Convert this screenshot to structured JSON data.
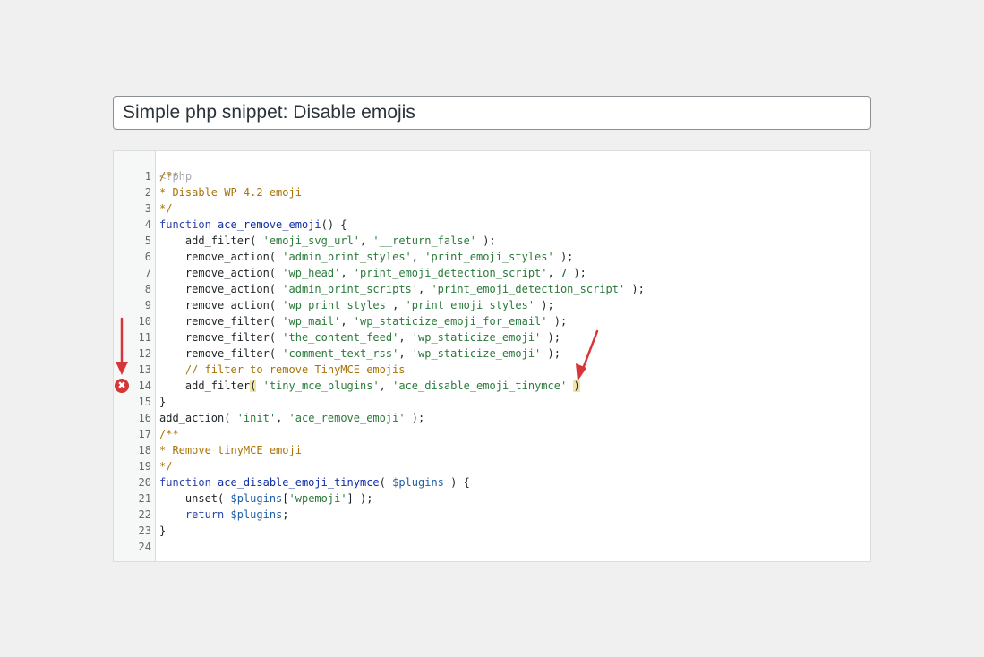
{
  "snippet": {
    "title_value": "Simple php snippet: Disable emojis"
  },
  "editor": {
    "php_open_tag": "<?php",
    "error_line": 14,
    "lines": [
      {
        "n": "1",
        "tokens": [
          [
            "comment",
            "/**"
          ]
        ]
      },
      {
        "n": "2",
        "tokens": [
          [
            "comment",
            "* Disable WP 4.2 emoji"
          ]
        ]
      },
      {
        "n": "3",
        "tokens": [
          [
            "comment",
            "*/"
          ]
        ]
      },
      {
        "n": "4",
        "tokens": [
          [
            "keyword",
            "function"
          ],
          [
            "plain",
            " "
          ],
          [
            "def",
            "ace_remove_emoji"
          ],
          [
            "plain",
            "() {"
          ]
        ]
      },
      {
        "n": "5",
        "tokens": [
          [
            "plain",
            "    add_filter( "
          ],
          [
            "string",
            "'emoji_svg_url'"
          ],
          [
            "plain",
            ", "
          ],
          [
            "string",
            "'__return_false'"
          ],
          [
            "plain",
            " );"
          ]
        ]
      },
      {
        "n": "6",
        "tokens": [
          [
            "plain",
            "    remove_action( "
          ],
          [
            "string",
            "'admin_print_styles'"
          ],
          [
            "plain",
            ", "
          ],
          [
            "string",
            "'print_emoji_styles'"
          ],
          [
            "plain",
            " );"
          ]
        ]
      },
      {
        "n": "7",
        "tokens": [
          [
            "plain",
            "    remove_action( "
          ],
          [
            "string",
            "'wp_head'"
          ],
          [
            "plain",
            ", "
          ],
          [
            "string",
            "'print_emoji_detection_script'"
          ],
          [
            "plain",
            ", "
          ],
          [
            "number",
            "7"
          ],
          [
            "plain",
            " );"
          ]
        ]
      },
      {
        "n": "8",
        "tokens": [
          [
            "plain",
            "    remove_action( "
          ],
          [
            "string",
            "'admin_print_scripts'"
          ],
          [
            "plain",
            ", "
          ],
          [
            "string",
            "'print_emoji_detection_script'"
          ],
          [
            "plain",
            " );"
          ]
        ]
      },
      {
        "n": "9",
        "tokens": [
          [
            "plain",
            "    remove_action( "
          ],
          [
            "string",
            "'wp_print_styles'"
          ],
          [
            "plain",
            ", "
          ],
          [
            "string",
            "'print_emoji_styles'"
          ],
          [
            "plain",
            " );"
          ]
        ]
      },
      {
        "n": "10",
        "tokens": [
          [
            "plain",
            "    remove_filter( "
          ],
          [
            "string",
            "'wp_mail'"
          ],
          [
            "plain",
            ", "
          ],
          [
            "string",
            "'wp_staticize_emoji_for_email'"
          ],
          [
            "plain",
            " );"
          ]
        ]
      },
      {
        "n": "11",
        "tokens": [
          [
            "plain",
            "    remove_filter( "
          ],
          [
            "string",
            "'the_content_feed'"
          ],
          [
            "plain",
            ", "
          ],
          [
            "string",
            "'wp_staticize_emoji'"
          ],
          [
            "plain",
            " );"
          ]
        ]
      },
      {
        "n": "12",
        "tokens": [
          [
            "plain",
            "    remove_filter( "
          ],
          [
            "string",
            "'comment_text_rss'"
          ],
          [
            "plain",
            ", "
          ],
          [
            "string",
            "'wp_staticize_emoji'"
          ],
          [
            "plain",
            " );"
          ]
        ]
      },
      {
        "n": "13",
        "tokens": [
          [
            "comment",
            "    // filter to remove TinyMCE emojis"
          ]
        ]
      },
      {
        "n": "14",
        "tokens": [
          [
            "plain",
            "    add_filter"
          ],
          [
            "bracket",
            "("
          ],
          [
            "plain",
            " "
          ],
          [
            "string",
            "'tiny_mce_plugins'"
          ],
          [
            "plain",
            ", "
          ],
          [
            "string",
            "'ace_disable_emoji_tinymce'"
          ],
          [
            "plain",
            " "
          ],
          [
            "bracket",
            ")"
          ]
        ]
      },
      {
        "n": "15",
        "tokens": [
          [
            "plain",
            "}"
          ]
        ]
      },
      {
        "n": "16",
        "tokens": [
          [
            "plain",
            "add_action( "
          ],
          [
            "string",
            "'init'"
          ],
          [
            "plain",
            ", "
          ],
          [
            "string",
            "'ace_remove_emoji'"
          ],
          [
            "plain",
            " );"
          ]
        ]
      },
      {
        "n": "17",
        "tokens": [
          [
            "comment",
            "/**"
          ]
        ]
      },
      {
        "n": "18",
        "tokens": [
          [
            "comment",
            "* Remove tinyMCE emoji"
          ]
        ]
      },
      {
        "n": "19",
        "tokens": [
          [
            "comment",
            "*/"
          ]
        ]
      },
      {
        "n": "20",
        "tokens": [
          [
            "keyword",
            "function"
          ],
          [
            "plain",
            " "
          ],
          [
            "def",
            "ace_disable_emoji_tinymce"
          ],
          [
            "plain",
            "( "
          ],
          [
            "variable",
            "$plugins"
          ],
          [
            "plain",
            " ) {"
          ]
        ]
      },
      {
        "n": "21",
        "tokens": [
          [
            "plain",
            "    unset( "
          ],
          [
            "variable",
            "$plugins"
          ],
          [
            "plain",
            "["
          ],
          [
            "string",
            "'wpemoji'"
          ],
          [
            "plain",
            "] );"
          ]
        ]
      },
      {
        "n": "22",
        "tokens": [
          [
            "plain",
            "    "
          ],
          [
            "keyword",
            "return"
          ],
          [
            "plain",
            " "
          ],
          [
            "variable",
            "$plugins"
          ],
          [
            "plain",
            ";"
          ]
        ]
      },
      {
        "n": "23",
        "tokens": [
          [
            "plain",
            "}"
          ]
        ]
      },
      {
        "n": "24",
        "tokens": []
      }
    ]
  },
  "colors": {
    "arrow": "#d63638",
    "error": "#d63638"
  }
}
